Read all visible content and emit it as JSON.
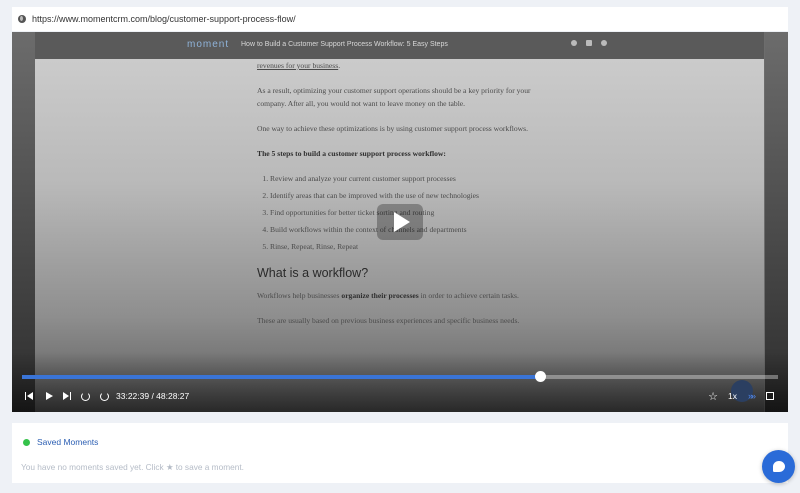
{
  "browser": {
    "url": "https://www.momentcrm.com/blog/customer-support-process-flow/"
  },
  "site_header": {
    "logo": "moment",
    "title": "How to Build a Customer Support Process Workflow: 5 Easy Steps",
    "social_icons": [
      "info-icon",
      "twitter-icon",
      "rss-icon"
    ]
  },
  "article": {
    "lead_link": "revenues for your business",
    "para1": "As a result, optimizing your customer support operations should be a key priority for your company. After all, you would not want to leave money on the table.",
    "para2": "One way to achieve these optimizations is by using customer support process workflows.",
    "steps_heading": "The 5 steps to build a customer support process workflow:",
    "steps": [
      "Review and analyze your current customer support processes",
      "Identify areas that can be improved with the use of new technologies",
      "Find opportunities for better ticket sorting and routing",
      "Build workflows within the context of channels and departments",
      "Rinse, Repeat, Rinse, Repeat"
    ],
    "h2": "What is a workflow?",
    "para3_pre": "Workflows help businesses ",
    "para3_bold": "organize their processes",
    "para3_post": " in order to achieve certain tasks.",
    "para4": "These are usually based on previous business experiences and specific business needs."
  },
  "player": {
    "progress_percent": 68.5,
    "timecode": "33:22:39 / 48:28:27",
    "speed": "1x",
    "fast_glyph": "»»",
    "accent_color": "#3a74d6"
  },
  "saved_moments": {
    "title": "Saved Moments",
    "empty_text": "You have no moments saved yet. Click ★ to save a moment.",
    "status_color": "#35c24a"
  }
}
